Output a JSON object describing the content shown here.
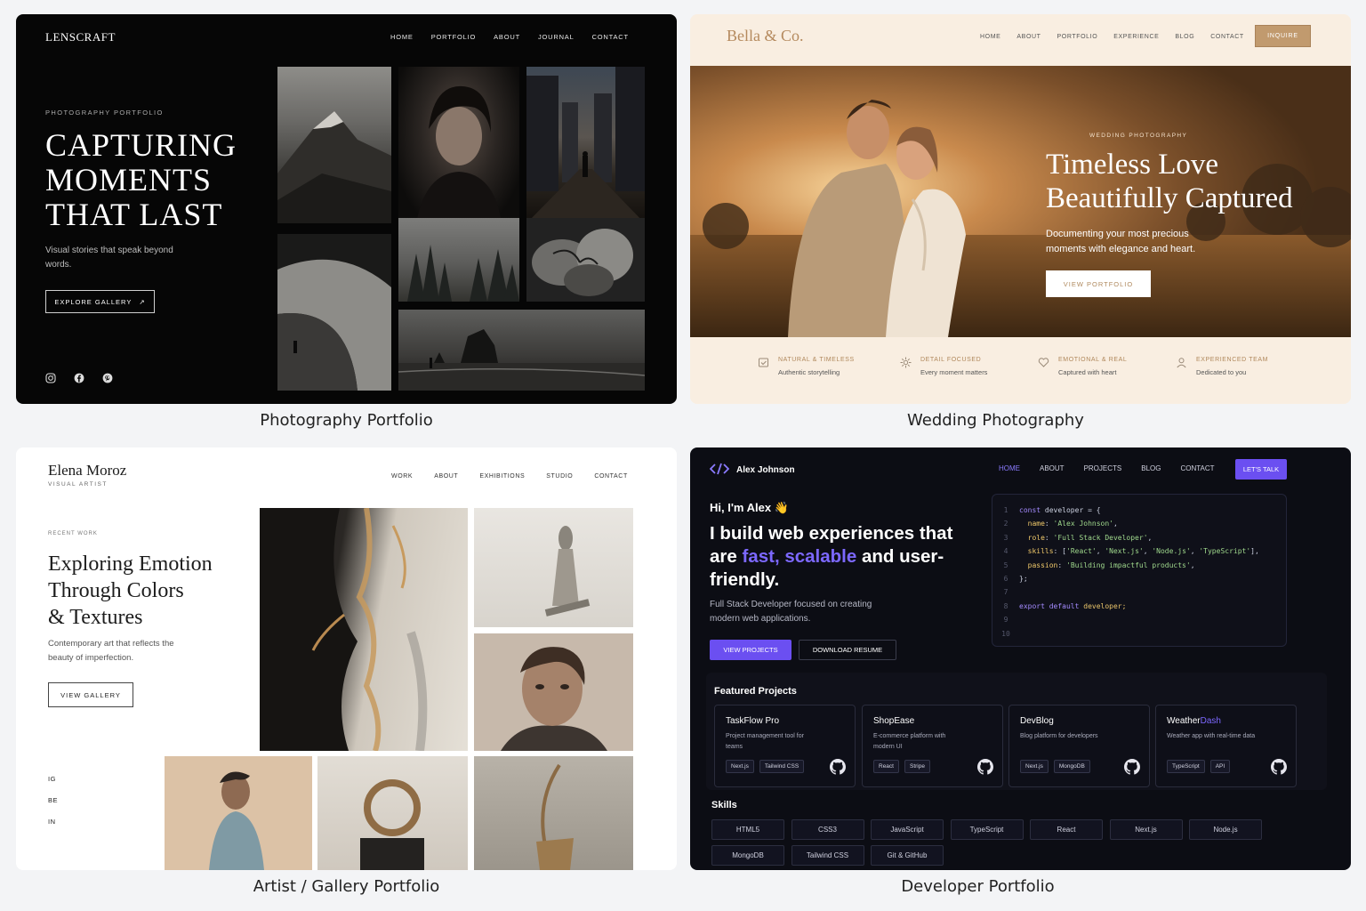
{
  "photo": {
    "logo": "LENSCRAFT",
    "nav": [
      "HOME",
      "PORTFOLIO",
      "ABOUT",
      "JOURNAL",
      "CONTACT"
    ],
    "kicker": "PHOTOGRAPHY PORTFOLIO",
    "headline": [
      "CAPTURING",
      "MOMENTS",
      "THAT LAST"
    ],
    "subtitle": "Visual stories that speak beyond words.",
    "cta": "EXPLORE GALLERY",
    "cta_arrow": "↗",
    "socials": [
      "instagram-icon",
      "facebook-icon",
      "pinterest-icon"
    ],
    "caption": "Photography Portfolio"
  },
  "wedding": {
    "logo": "Bella & Co.",
    "nav": [
      "HOME",
      "ABOUT",
      "PORTFOLIO",
      "EXPERIENCE",
      "BLOG",
      "CONTACT"
    ],
    "inquire": "INQUIRE",
    "kicker": "WEDDING PHOTOGRAPHY",
    "headline": [
      "Timeless Love",
      "Beautifully Captured"
    ],
    "subtitle": "Documenting your most precious moments with elegance and heart.",
    "cta": "VIEW PORTFOLIO",
    "features": [
      {
        "icon": "frame-check-icon",
        "title": "NATURAL & TIMELESS",
        "desc": "Authentic storytelling"
      },
      {
        "icon": "sparkle-icon",
        "title": "DETAIL FOCUSED",
        "desc": "Every moment matters"
      },
      {
        "icon": "heart-icon",
        "title": "EMOTIONAL & REAL",
        "desc": "Captured with heart"
      },
      {
        "icon": "user-icon",
        "title": "EXPERIENCED TEAM",
        "desc": "Dedicated to you"
      }
    ],
    "caption": "Wedding Photography"
  },
  "artist": {
    "name": "Elena Moroz",
    "tagline": "VISUAL ARTIST",
    "nav": [
      "WORK",
      "ABOUT",
      "EXHIBITIONS",
      "STUDIO",
      "CONTACT"
    ],
    "kicker": "RECENT WORK",
    "headline": [
      "Exploring Emotion",
      "Through Colors",
      "& Textures"
    ],
    "subtitle": "Contemporary art that reflects the beauty of imperfection.",
    "cta": "VIEW GALLERY",
    "socials": [
      "IG",
      "BE",
      "IN"
    ],
    "caption": "Artist / Gallery Portfolio"
  },
  "dev": {
    "name": "Alex Johnson",
    "nav": [
      "HOME",
      "ABOUT",
      "PROJECTS",
      "BLOG",
      "CONTACT"
    ],
    "cta_nav": "LET'S TALK",
    "greeting": "Hi, I'm Alex 👋",
    "headline_a": "I build web experiences that are ",
    "headline_accent": "fast, scalable",
    "headline_b": " and user-friendly.",
    "subtitle": "Full Stack Developer focused on creating modern web applications.",
    "cta_primary": "VIEW PROJECTS",
    "cta_secondary": "DOWNLOAD RESUME",
    "code_lines": [
      "const developer = {",
      "  name: 'Alex Johnson',",
      "  role: 'Full Stack Developer',",
      "  skills: ['React', 'Next.js', 'Node.js', 'TypeScript'],",
      "  passion: 'Building impactful products',",
      "};",
      "",
      "export default developer;",
      "",
      ""
    ],
    "featured_title": "Featured Projects",
    "projects": [
      {
        "name": "TaskFlow Pro",
        "accent": "",
        "desc": "Project management tool for teams",
        "tags": [
          "Next.js",
          "Tailwind CSS"
        ]
      },
      {
        "name": "ShopEase",
        "accent": "",
        "desc": "E-commerce platform with modern UI",
        "tags": [
          "React",
          "Stripe"
        ]
      },
      {
        "name": "DevBlog",
        "accent": "",
        "desc": "Blog platform for developers",
        "tags": [
          "Next.js",
          "MongoDB"
        ]
      },
      {
        "name": "Weather",
        "accent": "Dash",
        "desc": "Weather app with real-time data",
        "tags": [
          "TypeScript",
          "API"
        ]
      }
    ],
    "skills_title": "Skills",
    "skills": [
      "HTML5",
      "CSS3",
      "JavaScript",
      "TypeScript",
      "React",
      "Next.js",
      "Node.js",
      "MongoDB",
      "Tailwind CSS",
      "Git & GitHub"
    ],
    "caption": "Developer Portfolio"
  }
}
